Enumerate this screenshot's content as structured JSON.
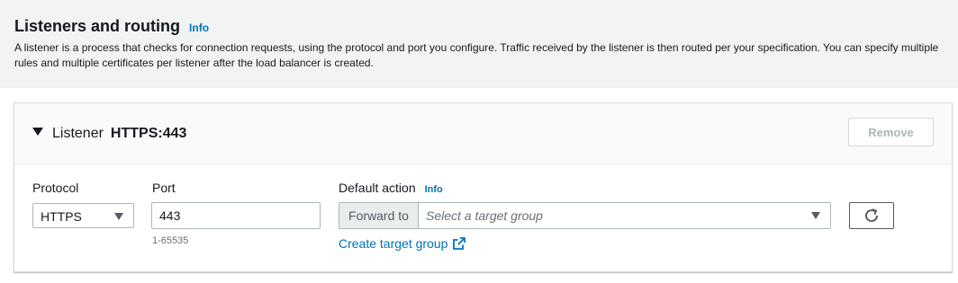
{
  "section": {
    "title": "Listeners and routing",
    "info_label": "Info",
    "description": "A listener is a process that checks for connection requests, using the protocol and port you configure. Traffic received by the listener is then routed per your specification. You can specify multiple rules and multiple certificates per listener after the load balancer is created."
  },
  "listener": {
    "label": "Listener",
    "value": "HTTPS:443",
    "remove_label": "Remove",
    "protocol": {
      "label": "Protocol",
      "selected": "HTTPS"
    },
    "port": {
      "label": "Port",
      "value": "443",
      "hint": "1-65535"
    },
    "separator": ":",
    "default_action": {
      "label": "Default action",
      "info_label": "Info",
      "forward_label": "Forward to",
      "target_placeholder": "Select a target group",
      "create_link": "Create target group"
    }
  },
  "colors": {
    "link": "#0073bb",
    "header_bg": "#f2f3f3",
    "border": "#aab7b8"
  },
  "icons": [
    "caret-down-icon",
    "external-link-icon",
    "refresh-icon"
  ]
}
